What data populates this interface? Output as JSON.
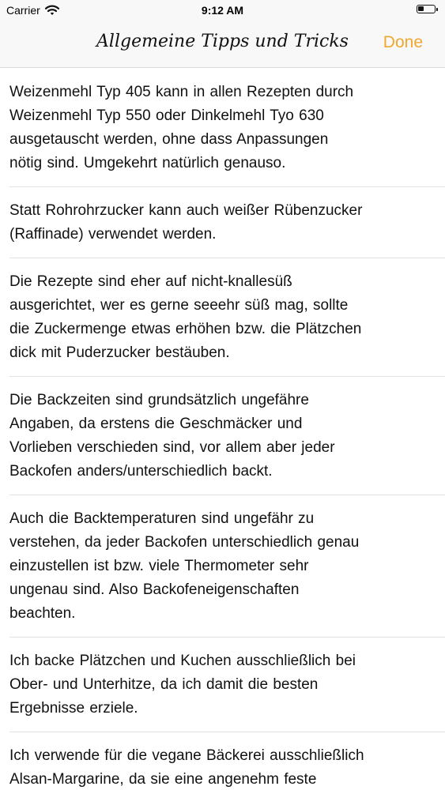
{
  "status": {
    "carrier": "Carrier",
    "time": "9:12 AM",
    "battery_level": 0.35
  },
  "nav": {
    "title": "Allgemeine Tipps und Tricks",
    "done_label": "Done"
  },
  "tips": [
    {
      "lines": [
        "Weizenmehl Typ 405 kann in allen Rezepten durch",
        "Weizenmehl Typ 550 oder Dinkelmehl Tyo 630",
        "ausgetauscht werden, ohne dass Anpassungen",
        "nötig sind. Umgekehrt natürlich genauso."
      ]
    },
    {
      "lines": [
        "Statt Rohrohrzucker kann auch weißer Rübenzucker",
        "(Raffinade) verwendet werden."
      ]
    },
    {
      "lines": [
        "Die Rezepte sind eher auf nicht-knallesüß",
        "ausgerichtet, wer es gerne seeehr süß mag, sollte",
        "die Zuckermenge etwas erhöhen bzw. die Plätzchen",
        "dick mit Puderzucker bestäuben."
      ]
    },
    {
      "lines": [
        "Die Backzeiten sind grundsätzlich ungefähre",
        "Angaben, da erstens die Geschmäcker und",
        "Vorlieben verschieden sind, vor allem aber jeder",
        "Backofen anders/unterschiedlich backt."
      ]
    },
    {
      "lines": [
        "Auch die Backtemperaturen sind ungefähr zu",
        "verstehen, da jeder Backofen unterschiedlich genau",
        "einzustellen ist bzw. viele Thermometer sehr",
        "ungenau sind. Also Backofeneigenschaften",
        "beachten."
      ]
    },
    {
      "lines": [
        "Ich backe Plätzchen und Kuchen ausschließlich bei",
        "Ober- und Unterhitze, da ich damit die besten",
        "Ergebnisse erziele."
      ]
    },
    {
      "lines": [
        "Ich verwende für die vegane Bäckerei ausschließlich",
        "Alsan-Margarine, da sie eine angenehm feste"
      ]
    }
  ]
}
